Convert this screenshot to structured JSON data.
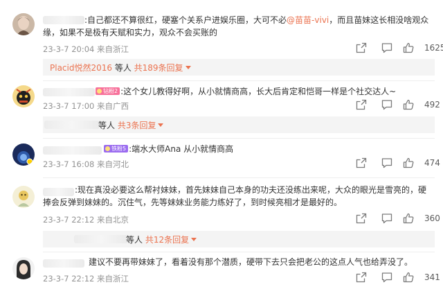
{
  "comments": [
    {
      "text_a": ":自己都还不算很红，硬塞个关系户进娱乐圈，大可不必",
      "mention": "@苗苗-vivi",
      "text_b": "，而且苗妹这长相没啥观众缘，如果不是极有天赋和实力，观众不会买账的",
      "date": "23-3-7 20:04",
      "location": "来自浙江",
      "likes": "1625",
      "reply": {
        "who": "Placid悦然2016",
        "suffix": " 等人 ",
        "more": "共189条回复"
      }
    },
    {
      "badge": "钻粉2",
      "text": ":这个女儿教得好啊，从小就情商高，长大后肯定和恺哥一样是个社交达人~",
      "date": "23-3-7 17:00",
      "location": "来自广西",
      "likes": "492",
      "reply": {
        "suffix": " 等人 ",
        "more": "共3条回复"
      }
    },
    {
      "badge": "铁粉5",
      "text": ":端水大师Ana 从小就情商高",
      "date": "23-3-7 16:08",
      "location": "来自河北",
      "likes": "474"
    },
    {
      "text": ":现在真没必要这么帮衬妹妹，首先妹妹自己本身的功夫还没练出来呢，大众的眼光是雪亮的，硬捧会反弹到妹妹的。沉住气，先等妹妹业务能力练好了，到时候亮相才是最好的。",
      "date": "23-3-7 22:12",
      "location": "来自北京",
      "likes": "360",
      "reply": {
        "suffix": " 等人 ",
        "more": "共12条回复"
      }
    },
    {
      "text": "建议不要再带妹妹了，看着没有那个潜质，硬带下去只会把老公的这点人气也给弄没了。",
      "date": "23-3-7 22:12",
      "location": "来自浙江",
      "likes": "341"
    }
  ],
  "colors": {
    "accent": "#eb7350",
    "meta": "#939393",
    "badge_pink": "#f7709a",
    "badge_purple": "#9b6cf0"
  },
  "icons": [
    "share-icon",
    "comment-icon",
    "like-icon"
  ]
}
